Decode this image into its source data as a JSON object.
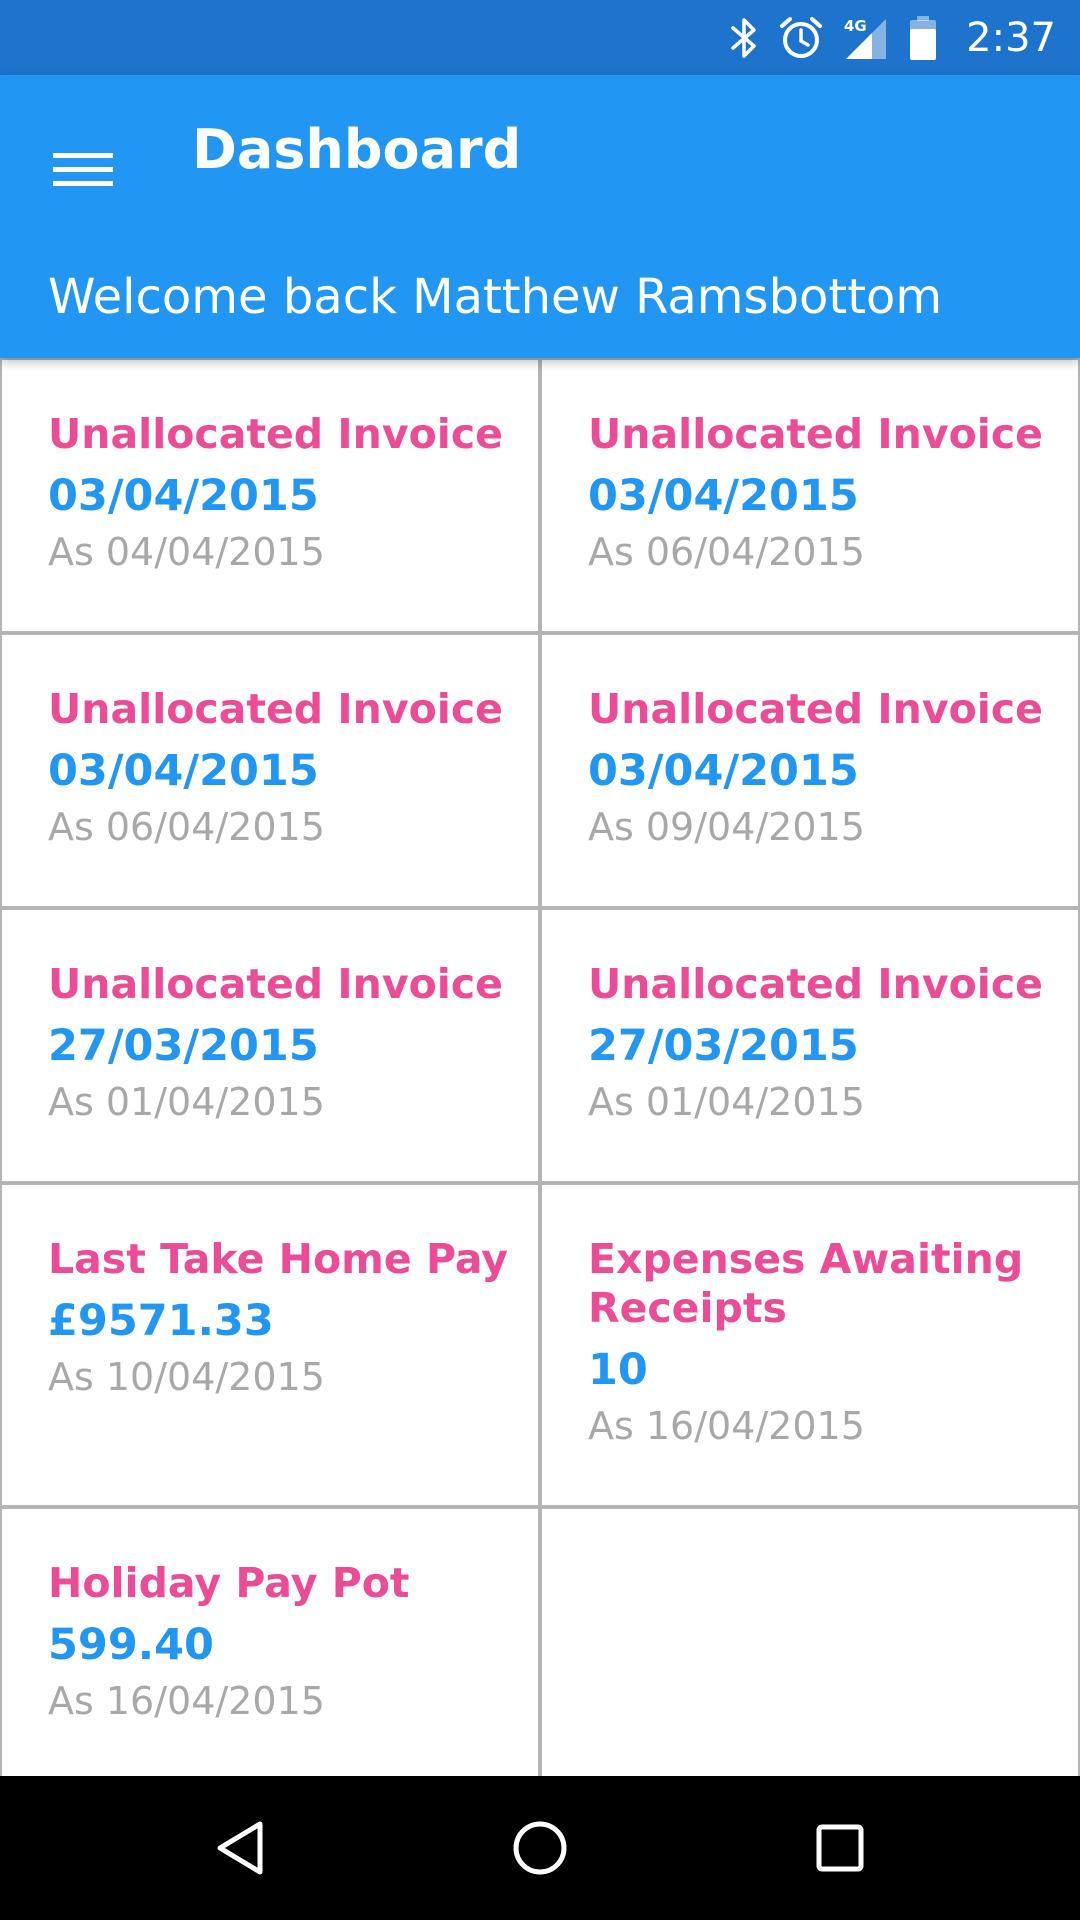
{
  "status_bar": {
    "time": "2:37",
    "network_label": "4G",
    "icons": [
      "bluetooth-icon",
      "alarm-icon",
      "signal-icon",
      "battery-icon"
    ]
  },
  "app_bar": {
    "menu_icon": "hamburger-menu-icon",
    "title": "Dashboard",
    "welcome": "Welcome back Matthew Ramsbottom"
  },
  "tiles": [
    {
      "title": "Unallocated Invoice",
      "value": "03/04/2015",
      "date": "As 04/04/2015"
    },
    {
      "title": "Unallocated Invoice",
      "value": "03/04/2015",
      "date": "As 06/04/2015"
    },
    {
      "title": "Unallocated Invoice",
      "value": "03/04/2015",
      "date": "As 06/04/2015"
    },
    {
      "title": "Unallocated Invoice",
      "value": "03/04/2015",
      "date": "As 09/04/2015"
    },
    {
      "title": "Unallocated Invoice",
      "value": "27/03/2015",
      "date": "As 01/04/2015"
    },
    {
      "title": "Unallocated Invoice",
      "value": "27/03/2015",
      "date": "As 01/04/2015"
    },
    {
      "title": "Last Take Home Pay",
      "value": "£9571.33",
      "date": "As 10/04/2015"
    },
    {
      "title": "Expenses Awaiting\nReceipts",
      "value": "10",
      "date": "As 16/04/2015"
    },
    {
      "title": "Holiday Pay Pot",
      "value": "599.40",
      "date": "As 16/04/2015"
    }
  ],
  "nav_bar": {
    "icons": [
      "back-icon",
      "home-icon",
      "recents-icon"
    ]
  },
  "colors": {
    "status_bar": "#1e74cc",
    "app_bar": "#2196f3",
    "tile_title": "#ec4c96",
    "tile_value": "#2196f3",
    "tile_date": "#a8a8a8",
    "tile_border": "#b4b4b4",
    "nav_bar": "#000000"
  }
}
